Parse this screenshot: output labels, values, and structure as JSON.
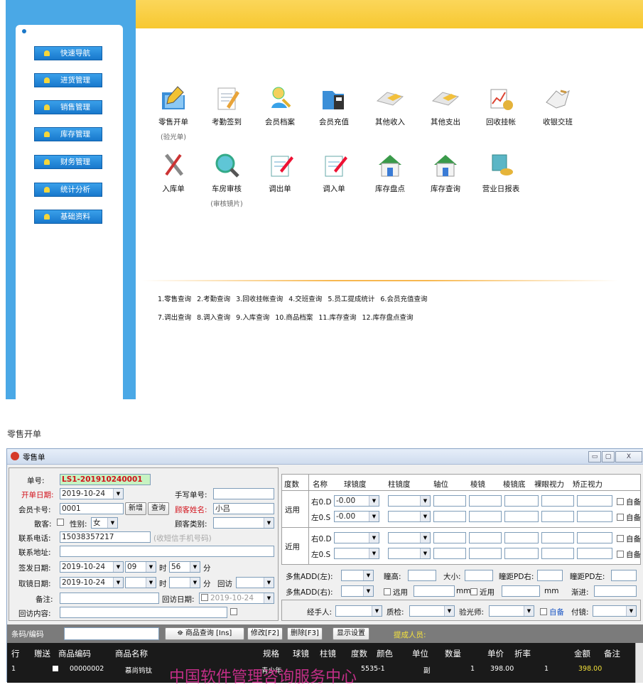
{
  "nav": {
    "items": [
      "快速导航",
      "进货管理",
      "销售管理",
      "库存管理",
      "财务管理",
      "统计分析",
      "基础资料"
    ]
  },
  "tiles": {
    "r1": [
      {
        "label": "零售开单",
        "sub": "(验光单)"
      },
      {
        "label": "考勤签到"
      },
      {
        "label": "会员档案"
      },
      {
        "label": "会员充值"
      },
      {
        "label": "其他收入"
      },
      {
        "label": "其他支出"
      },
      {
        "label": "回收挂帐"
      },
      {
        "label": "收银交班"
      }
    ],
    "r2": [
      {
        "label": "入库单"
      },
      {
        "label": "车房审核",
        "sub": "(审核镜片)"
      },
      {
        "label": "调出单"
      },
      {
        "label": "调入单"
      },
      {
        "label": "库存盘点"
      },
      {
        "label": "库存查询"
      },
      {
        "label": "营业日报表"
      }
    ]
  },
  "quick": {
    "row1": [
      "1.零售查询",
      "2.考勤查询",
      "3.回收挂帐查询",
      "4.交班查询",
      "5.员工提成统计",
      "6.会员充值查询"
    ],
    "row2": [
      "7.调出查询",
      "8.调入查询",
      "9.入库查询",
      "10.商品档案",
      "11.库存查询",
      "12.库存盘点查询"
    ]
  },
  "page_caption": "零售开单",
  "window": {
    "title": "零售单",
    "btn_min": "▭",
    "btn_max": "▢",
    "btn_close": "X"
  },
  "form": {
    "order_no_label": "单号:",
    "order_no": "LS1-201910240001",
    "open_date_label": "开单日期:",
    "open_date": "2019-10-24",
    "handwrite_label": "手写单号:",
    "card_label": "会员卡号:",
    "card": "0001",
    "add_btn": "新增",
    "query_btn": "查询",
    "name_label": "顾客姓名:",
    "name": "小吕",
    "walkin_label": "散客:",
    "gender_label": "性别:",
    "gender": "女",
    "ctype_label": "顾客类别:",
    "phone_label": "联系电话:",
    "phone": "15038357217",
    "phone_hint": "(收短信手机号码)",
    "addr_label": "联系地址:",
    "issue_label": "签发日期:",
    "issue_date": "2019-10-24",
    "issue_hour": "09",
    "hour_unit": "时",
    "issue_min": "56",
    "min_unit": "分",
    "pickup_label": "取镜日期:",
    "pickup_date": "2019-10-24",
    "revisit_label": "回访",
    "remark_label": "备注:",
    "revisit_date_label": "回访日期:",
    "revisit_date": "2019-10-24",
    "revisit_content_label": "回访内容:"
  },
  "rx": {
    "headers": [
      "度数",
      "名称",
      "球镜度",
      "柱镜度",
      "轴位",
      "棱镜",
      "棱镜底",
      "裸眼视力",
      "矫正视力"
    ],
    "far": "远用",
    "near": "近用",
    "rows": [
      {
        "eye": "右0.D",
        "sph": "-0.00"
      },
      {
        "eye": "左0.S",
        "sph": "-0.00"
      },
      {
        "eye": "右0.D",
        "sph": ""
      },
      {
        "eye": "左0.S",
        "sph": ""
      }
    ],
    "self": "自备",
    "add_l": "多焦ADD(左):",
    "add_r": "多焦ADD(右):",
    "pupil_h": "瞳高:",
    "size": "大小:",
    "pd_r": "瞳距PD右:",
    "pd_l": "瞳距PD左:",
    "far_use": "远用",
    "mm": "mm",
    "near_use": "近用",
    "gradual": "渐进:",
    "handler": "经手人:",
    "qc": "质检:",
    "optom": "验光师:",
    "self2": "自备",
    "glasses": "付镜:"
  },
  "toolbar": {
    "barcode_label": "条码/编码",
    "goods_query": "商品查询 [Ins]",
    "modify": "修改[F2]",
    "delete": "删除[F3]",
    "display": "显示设置",
    "commission": "提成人员:"
  },
  "table": {
    "headers": [
      "行",
      "赠送",
      "商品编码",
      "商品名称",
      "规格",
      "球镜",
      "柱镜",
      "度数",
      "颜色",
      "单位",
      "数量",
      "单价",
      "折率",
      "金额",
      "备注"
    ],
    "row": {
      "no": "1",
      "code": "00000002",
      "name": "慕尚钨钛",
      "spec": "青少年",
      "degree": "5535-1",
      "unit": "副",
      "qty": "1",
      "price": "398.00",
      "rate": "1",
      "amount": "398.00"
    }
  },
  "watermark": "中国软件管理咨询服务中心",
  "colors": {
    "sidebar": "#4aa8e6",
    "header": "#f7c830",
    "accent_red": "#d2121b",
    "amount": "#f2e03a"
  }
}
